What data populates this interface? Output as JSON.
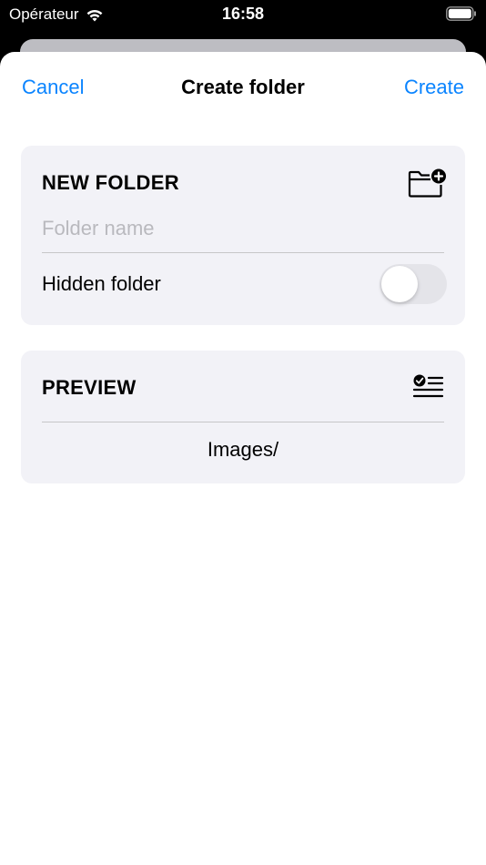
{
  "status_bar": {
    "carrier": "Opérateur",
    "time": "16:58",
    "wifi_icon": "wifi-icon",
    "battery_icon": "battery-icon"
  },
  "nav": {
    "cancel_label": "Cancel",
    "title": "Create folder",
    "create_label": "Create"
  },
  "new_folder_section": {
    "header": "NEW FOLDER",
    "icon": "folder-add-icon",
    "name_placeholder": "Folder name",
    "name_value": "",
    "hidden_label": "Hidden folder",
    "hidden_on": false
  },
  "preview_section": {
    "header": "PREVIEW",
    "icon": "checklist-icon",
    "path": "Images/"
  },
  "colors": {
    "accent": "#0a84ff",
    "section_bg": "#f2f2f7",
    "toggle_off": "#e4e4e9"
  }
}
